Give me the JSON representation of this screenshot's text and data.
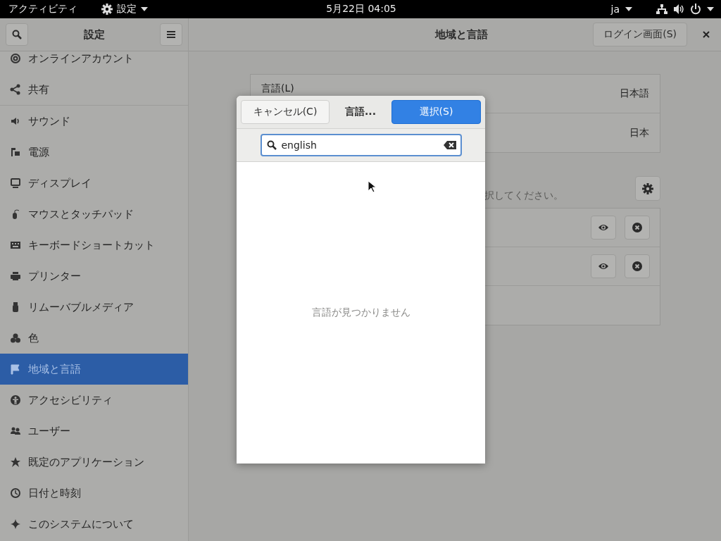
{
  "top_bar": {
    "activities": "アクティビティ",
    "app_menu": "設定",
    "clock": "5月22日 04:05",
    "input_indicator": "ja"
  },
  "sidebar": {
    "title": "設定",
    "groups": [
      [
        {
          "label": "オンラインアカウント",
          "selected": false
        },
        {
          "label": "共有",
          "selected": false
        }
      ],
      [
        {
          "label": "サウンド",
          "selected": false
        },
        {
          "label": "電源",
          "selected": false
        },
        {
          "label": "ディスプレイ",
          "selected": false
        },
        {
          "label": "マウスとタッチパッド",
          "selected": false
        },
        {
          "label": "キーボードショートカット",
          "selected": false
        },
        {
          "label": "プリンター",
          "selected": false
        },
        {
          "label": "リムーバブルメディア",
          "selected": false
        },
        {
          "label": "色",
          "selected": false
        },
        {
          "label": "地域と言語",
          "selected": true
        },
        {
          "label": "アクセシビリティ",
          "selected": false
        },
        {
          "label": "ユーザー",
          "selected": false
        },
        {
          "label": "既定のアプリケーション",
          "selected": false
        },
        {
          "label": "日付と時刻",
          "selected": false
        },
        {
          "label": "このシステムについて",
          "selected": false
        }
      ]
    ]
  },
  "header": {
    "title": "地域と言語",
    "login_button": "ログイン画面(S)"
  },
  "settings_rows": [
    {
      "label": "言語(L)",
      "value": "日本語"
    },
    {
      "value": "日本"
    }
  ],
  "input_sources": {
    "hint": "択してください。"
  },
  "dialog": {
    "cancel": "キャンセル(C)",
    "title": "言語...",
    "select": "選択(S)",
    "search": {
      "value": "english"
    },
    "empty_message": "言語が見つかりません"
  }
}
